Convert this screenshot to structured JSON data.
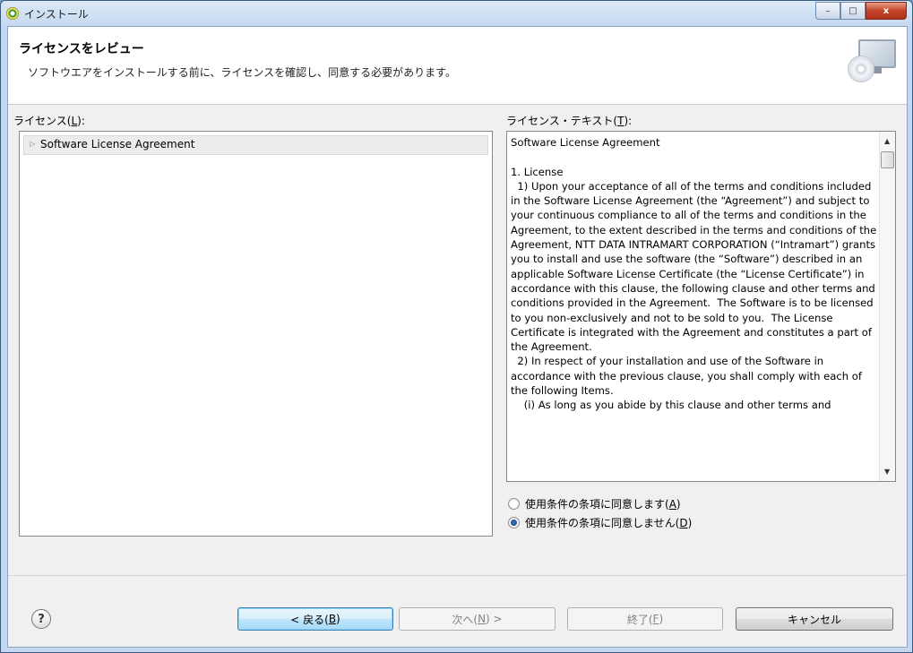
{
  "window": {
    "title": "インストール",
    "controls": {
      "minimize": "–",
      "maximize": "□",
      "close": "x"
    }
  },
  "banner": {
    "title": "ライセンスをレビュー",
    "description": "ソフトウエアをインストールする前に、ライセンスを確認し、同意する必要があります。"
  },
  "licenses": {
    "label_prefix": "ライセンス(",
    "label_mnemonic": "L",
    "label_suffix": "):",
    "items": [
      {
        "label": "Software License Agreement"
      }
    ]
  },
  "license_text": {
    "label_prefix": "ライセンス・テキスト(",
    "label_mnemonic": "T",
    "label_suffix": "):",
    "content": "Software License Agreement\n\n1. License\n  1) Upon your acceptance of all of the terms and conditions included in the Software License Agreement (the “Agreement”) and subject to your continuous compliance to all of the terms and conditions in the Agreement, to the extent described in the terms and conditions of the Agreement, NTT DATA INTRAMART CORPORATION (“Intramart”) grants you to install and use the software (the “Software”) described in an applicable Software License Certificate (the “License Certificate”) in accordance with this clause, the following clause and other terms and conditions provided in the Agreement.  The Software is to be licensed to you non-exclusively and not to be sold to you.  The License Certificate is integrated with the Agreement and constitutes a part of the Agreement.\n  2) In respect of your installation and use of the Software in accordance with the previous clause, you shall comply with each of the following Items.\n    (i) As long as you abide by this clause and other terms and"
  },
  "radios": {
    "accept": {
      "prefix": "使用条件の条項に同意します(",
      "mnemonic": "A",
      "suffix": ")",
      "checked": false
    },
    "decline": {
      "prefix": "使用条件の条項に同意しません(",
      "mnemonic": "D",
      "suffix": ")",
      "checked": true
    }
  },
  "buttons": {
    "back": {
      "prefix": "< 戻る(",
      "mnemonic": "B",
      "suffix": ")"
    },
    "next": {
      "prefix": "次へ(",
      "mnemonic": "N",
      "suffix": ") >"
    },
    "finish": {
      "prefix": "終了(",
      "mnemonic": "F",
      "suffix": ")"
    },
    "cancel": {
      "label": "キャンセル"
    }
  },
  "icons": {
    "help": "?",
    "tree_expand": "▷",
    "scroll_up": "▲",
    "scroll_down": "▼"
  }
}
